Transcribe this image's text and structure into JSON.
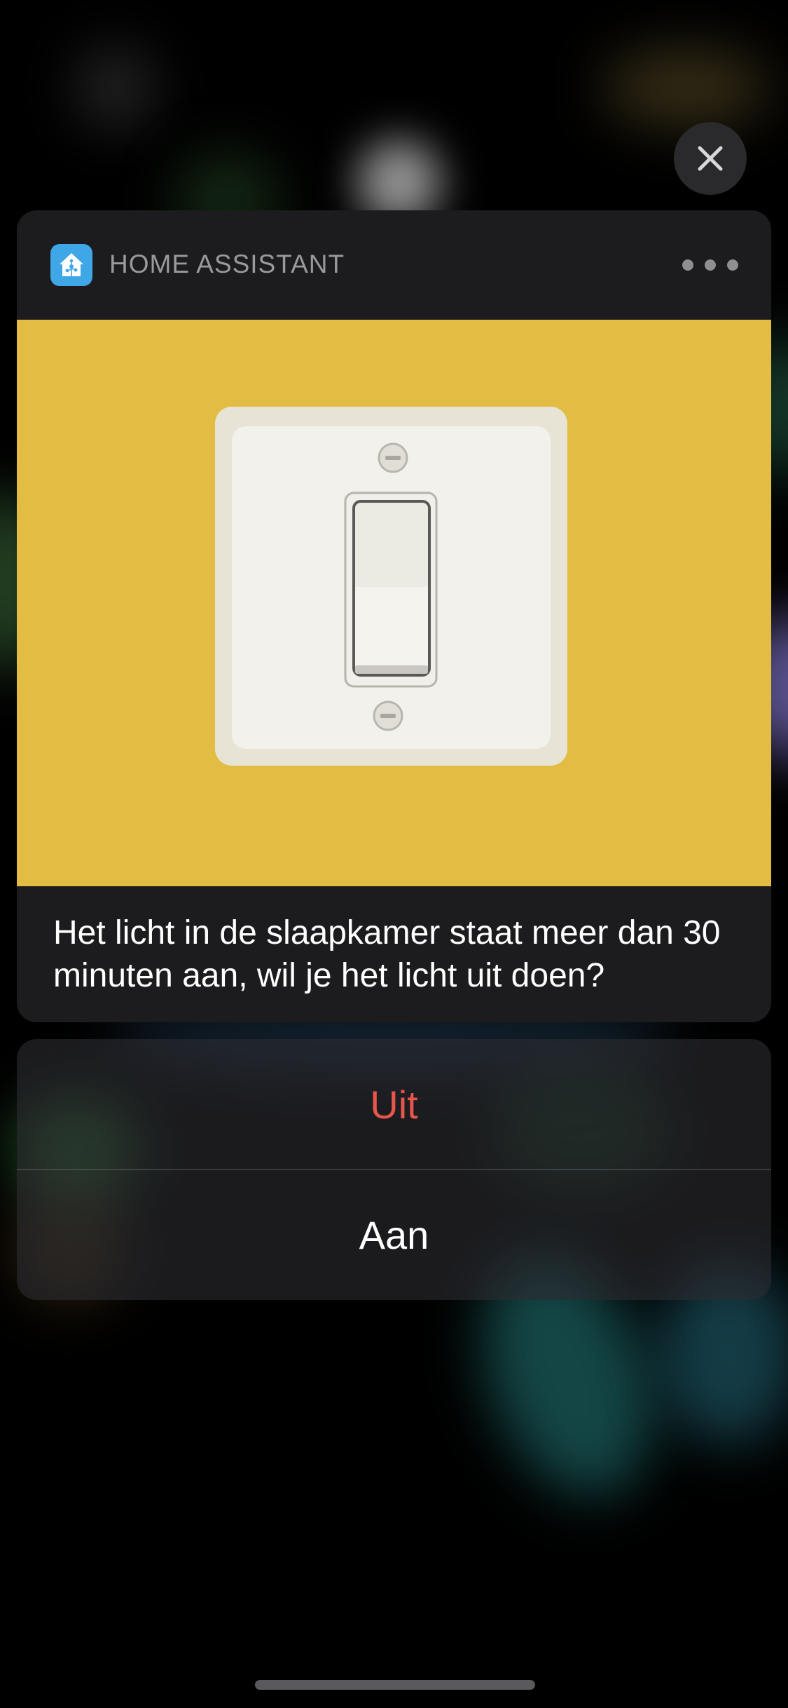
{
  "notification": {
    "app_name": "HOME ASSISTANT",
    "app_icon": "home-assistant-icon",
    "image": "light-switch-illustration",
    "message": "Het licht in de slaapkamer staat meer dan 30 minuten aan, wil je het licht uit doen?",
    "hero_color": "#e3bc44"
  },
  "actions": [
    {
      "label": "Uit",
      "color": "#e8554b"
    },
    {
      "label": "Aan",
      "color": "#ffffff"
    }
  ],
  "controls": {
    "close": "close-icon",
    "more": "more-options-icon"
  }
}
